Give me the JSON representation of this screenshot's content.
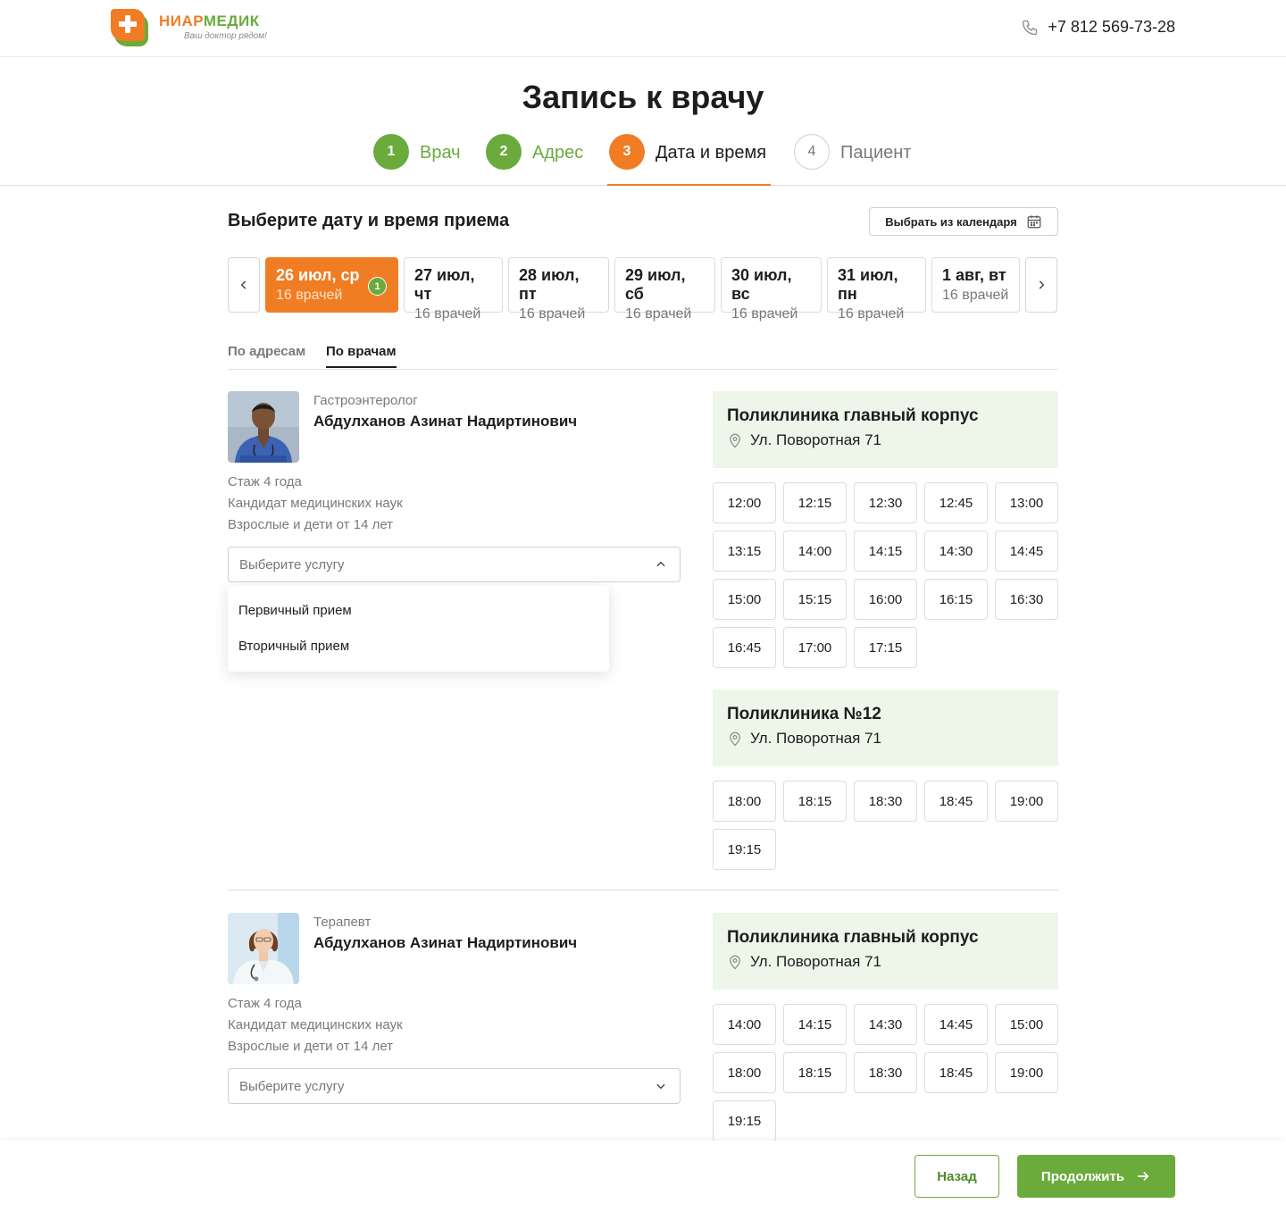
{
  "header": {
    "logo_name_a": "НИАР",
    "logo_name_b": "МЕДИК",
    "logo_slogan": "Ваш доктор рядом!",
    "phone": "+7 812 569-73-28",
    "phone_icon": "phone-icon"
  },
  "page": {
    "title": "Запись к врачу"
  },
  "steps": [
    {
      "num": "1",
      "label": "Врач",
      "state": "done"
    },
    {
      "num": "2",
      "label": "Адрес",
      "state": "done"
    },
    {
      "num": "3",
      "label": "Дата и время",
      "state": "active"
    },
    {
      "num": "4",
      "label": "Пациент",
      "state": "todo"
    }
  ],
  "section": {
    "title": "Выберите дату и время приема",
    "calendar_button": "Выбрать из календаря",
    "calendar_icon": "calendar-icon"
  },
  "dates": [
    {
      "date": "26 июл, ср",
      "count": "16 врачей",
      "selected": true,
      "badge": "1"
    },
    {
      "date": "27 июл, чт",
      "count": "16 врачей"
    },
    {
      "date": "28 июл, пт",
      "count": "16 врачей"
    },
    {
      "date": "29 июл, сб",
      "count": "16 врачей"
    },
    {
      "date": "30 июл, вс",
      "count": "16 врачей"
    },
    {
      "date": "31 июл, пн",
      "count": "16 врачей"
    },
    {
      "date": "1 авг, вт",
      "count": "16 врачей"
    }
  ],
  "tabs": [
    {
      "label": "По адресам",
      "active": false
    },
    {
      "label": "По врачам",
      "active": true
    }
  ],
  "doctors": [
    {
      "specialty": "Гастроэнтеролог",
      "name": "Абдулханов Азинат Надиртинович",
      "experience": "Стаж 4 года",
      "degree": "Кандидат медицинских наук",
      "patients": "Взрослые и дети от 14 лет",
      "service_placeholder": "Выберите услугу",
      "dropdown_open": true,
      "dropdown_options": [
        "Первичный прием",
        "Вторичный прием"
      ],
      "clinics": [
        {
          "name": "Поликлиника главный корпус",
          "address": "Ул. Поворотная 71",
          "slots": [
            "12:00",
            "12:15",
            "12:30",
            "12:45",
            "13:00",
            "13:15",
            "14:00",
            "14:15",
            "14:30",
            "14:45",
            "15:00",
            "15:15",
            "16:00",
            "16:15",
            "16:30",
            "16:45",
            "17:00",
            "17:15"
          ]
        },
        {
          "name": "Поликлиника №12",
          "address": "Ул. Поворотная 71",
          "slots": [
            "18:00",
            "18:15",
            "18:30",
            "18:45",
            "19:00",
            "19:15"
          ]
        }
      ]
    },
    {
      "specialty": "Терапевт",
      "name": "Абдулханов Азинат Надиртинович",
      "experience": "Стаж 4 года",
      "degree": "Кандидат медицинских наук",
      "patients": "Взрослые и дети от 14 лет",
      "service_placeholder": "Выберите услугу",
      "dropdown_open": false,
      "clinics": [
        {
          "name": "Поликлиника главный корпус",
          "address": "Ул. Поворотная 71",
          "slots": [
            "14:00",
            "14:15",
            "14:30",
            "14:45",
            "15:00",
            "18:00",
            "18:15",
            "18:30",
            "18:45",
            "19:00",
            "19:15"
          ]
        }
      ]
    }
  ],
  "footer": {
    "back": "Назад",
    "next": "Продолжить"
  },
  "colors": {
    "brand_orange": "#f07d24",
    "brand_green": "#6aab3c",
    "clinic_bg": "#eef6ea"
  }
}
